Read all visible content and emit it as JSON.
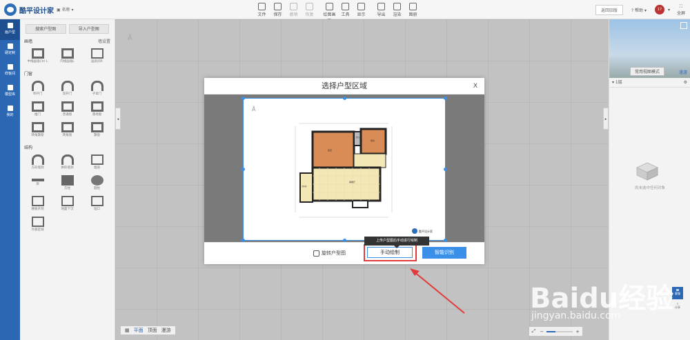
{
  "app": {
    "name": "酷平设计家",
    "project": "名称"
  },
  "toolbar": [
    {
      "label": "文件",
      "icon": "file-icon",
      "enabled": true
    },
    {
      "label": "保存",
      "icon": "save-icon",
      "enabled": true
    },
    {
      "label": "撤销",
      "icon": "undo-icon",
      "enabled": false
    },
    {
      "label": "恢复",
      "icon": "redo-icon",
      "enabled": false
    },
    {
      "label": "绘图画板",
      "icon": "draw-icon",
      "enabled": true
    },
    {
      "label": "工具",
      "icon": "tool-icon",
      "enabled": true
    },
    {
      "label": "显示",
      "icon": "display-icon",
      "enabled": true
    },
    {
      "label": "导出",
      "icon": "export-icon",
      "enabled": true
    },
    {
      "label": "渲染",
      "icon": "render-icon",
      "enabled": true
    },
    {
      "label": "图册",
      "icon": "album-icon",
      "enabled": true
    }
  ],
  "topright": {
    "old_version": "返回旧版",
    "help": "帮助",
    "avatar_text": "17",
    "fullscreen": "全屏"
  },
  "leftnav": [
    {
      "label": "画户型",
      "icon": "floorplan-icon"
    },
    {
      "label": "硬定制",
      "icon": "custom-icon"
    },
    {
      "label": "样板间",
      "icon": "showroom-icon"
    },
    {
      "label": "模型库",
      "icon": "model-icon"
    },
    {
      "label": "我的",
      "icon": "user-icon"
    }
  ],
  "panel": {
    "tabs": [
      "搜索户型图",
      "导入户型图"
    ],
    "sections": [
      {
        "title": "画墙",
        "link": "墙设置",
        "items": [
          {
            "label": "中线画墙Ctrl L",
            "shape": "wall"
          },
          {
            "label": "内线画墙L",
            "shape": "wall"
          },
          {
            "label": "画房间R",
            "shape": "box"
          }
        ]
      },
      {
        "title": "门窗",
        "link": "",
        "items": [
          {
            "label": "单开门",
            "shape": "door"
          },
          {
            "label": "双开门",
            "shape": "door"
          },
          {
            "label": "子母门",
            "shape": "door"
          },
          {
            "label": "推门",
            "shape": "wall"
          },
          {
            "label": "普通窗",
            "shape": "wall"
          },
          {
            "label": "落地窗",
            "shape": "wall"
          },
          {
            "label": "转角飘窗",
            "shape": "wall"
          },
          {
            "label": "转角窗",
            "shape": "wall"
          },
          {
            "label": "飘窗",
            "shape": "wall"
          }
        ]
      },
      {
        "title": "结构",
        "link": "",
        "items": [
          {
            "label": "方形墙洞",
            "shape": "door"
          },
          {
            "label": "拱形墙洞",
            "shape": "door"
          },
          {
            "label": "烟道",
            "shape": "box"
          },
          {
            "label": "梁",
            "shape": "bar"
          },
          {
            "label": "方柱",
            "shape": "sq"
          },
          {
            "label": "圆柱",
            "shape": "circ"
          },
          {
            "label": "楼板开洞",
            "shape": "box"
          },
          {
            "label": "地面下沉",
            "shape": "box"
          },
          {
            "label": "垭口",
            "shape": "box"
          },
          {
            "label": "外部区域",
            "shape": "box"
          }
        ]
      }
    ]
  },
  "canvas": {
    "view_tabs": [
      "平面",
      "顶面",
      "漫游"
    ],
    "zoom_minus": "−",
    "zoom_plus": "+",
    "zoom_level": 0.35
  },
  "rightpanel": {
    "view_mode": "常用视图模式",
    "walk": "漫游",
    "floor": "1层",
    "empty": "尚未选中任何对象",
    "service": "客服",
    "share": "分享"
  },
  "modal": {
    "title": "选择户型区域",
    "close": "X",
    "rotate": "旋转户型图",
    "manual": "手动绘制",
    "smart": "智能识别",
    "tooltip": "上传户型图后手动进行绘制",
    "plan_logo": "酷平设计家",
    "rooms": [
      "卧室",
      "卫生间",
      "厨房",
      "客餐厅",
      "次卧室"
    ]
  },
  "watermark": {
    "brand": "Baidu经验",
    "url": "jingyan.baidu.com"
  },
  "colors": {
    "nav": "#2c67b3",
    "accent": "#3a8fe8",
    "highlight": "#e03a3a",
    "room_orange": "#d98c55",
    "room_cream": "#f3e7b5"
  }
}
